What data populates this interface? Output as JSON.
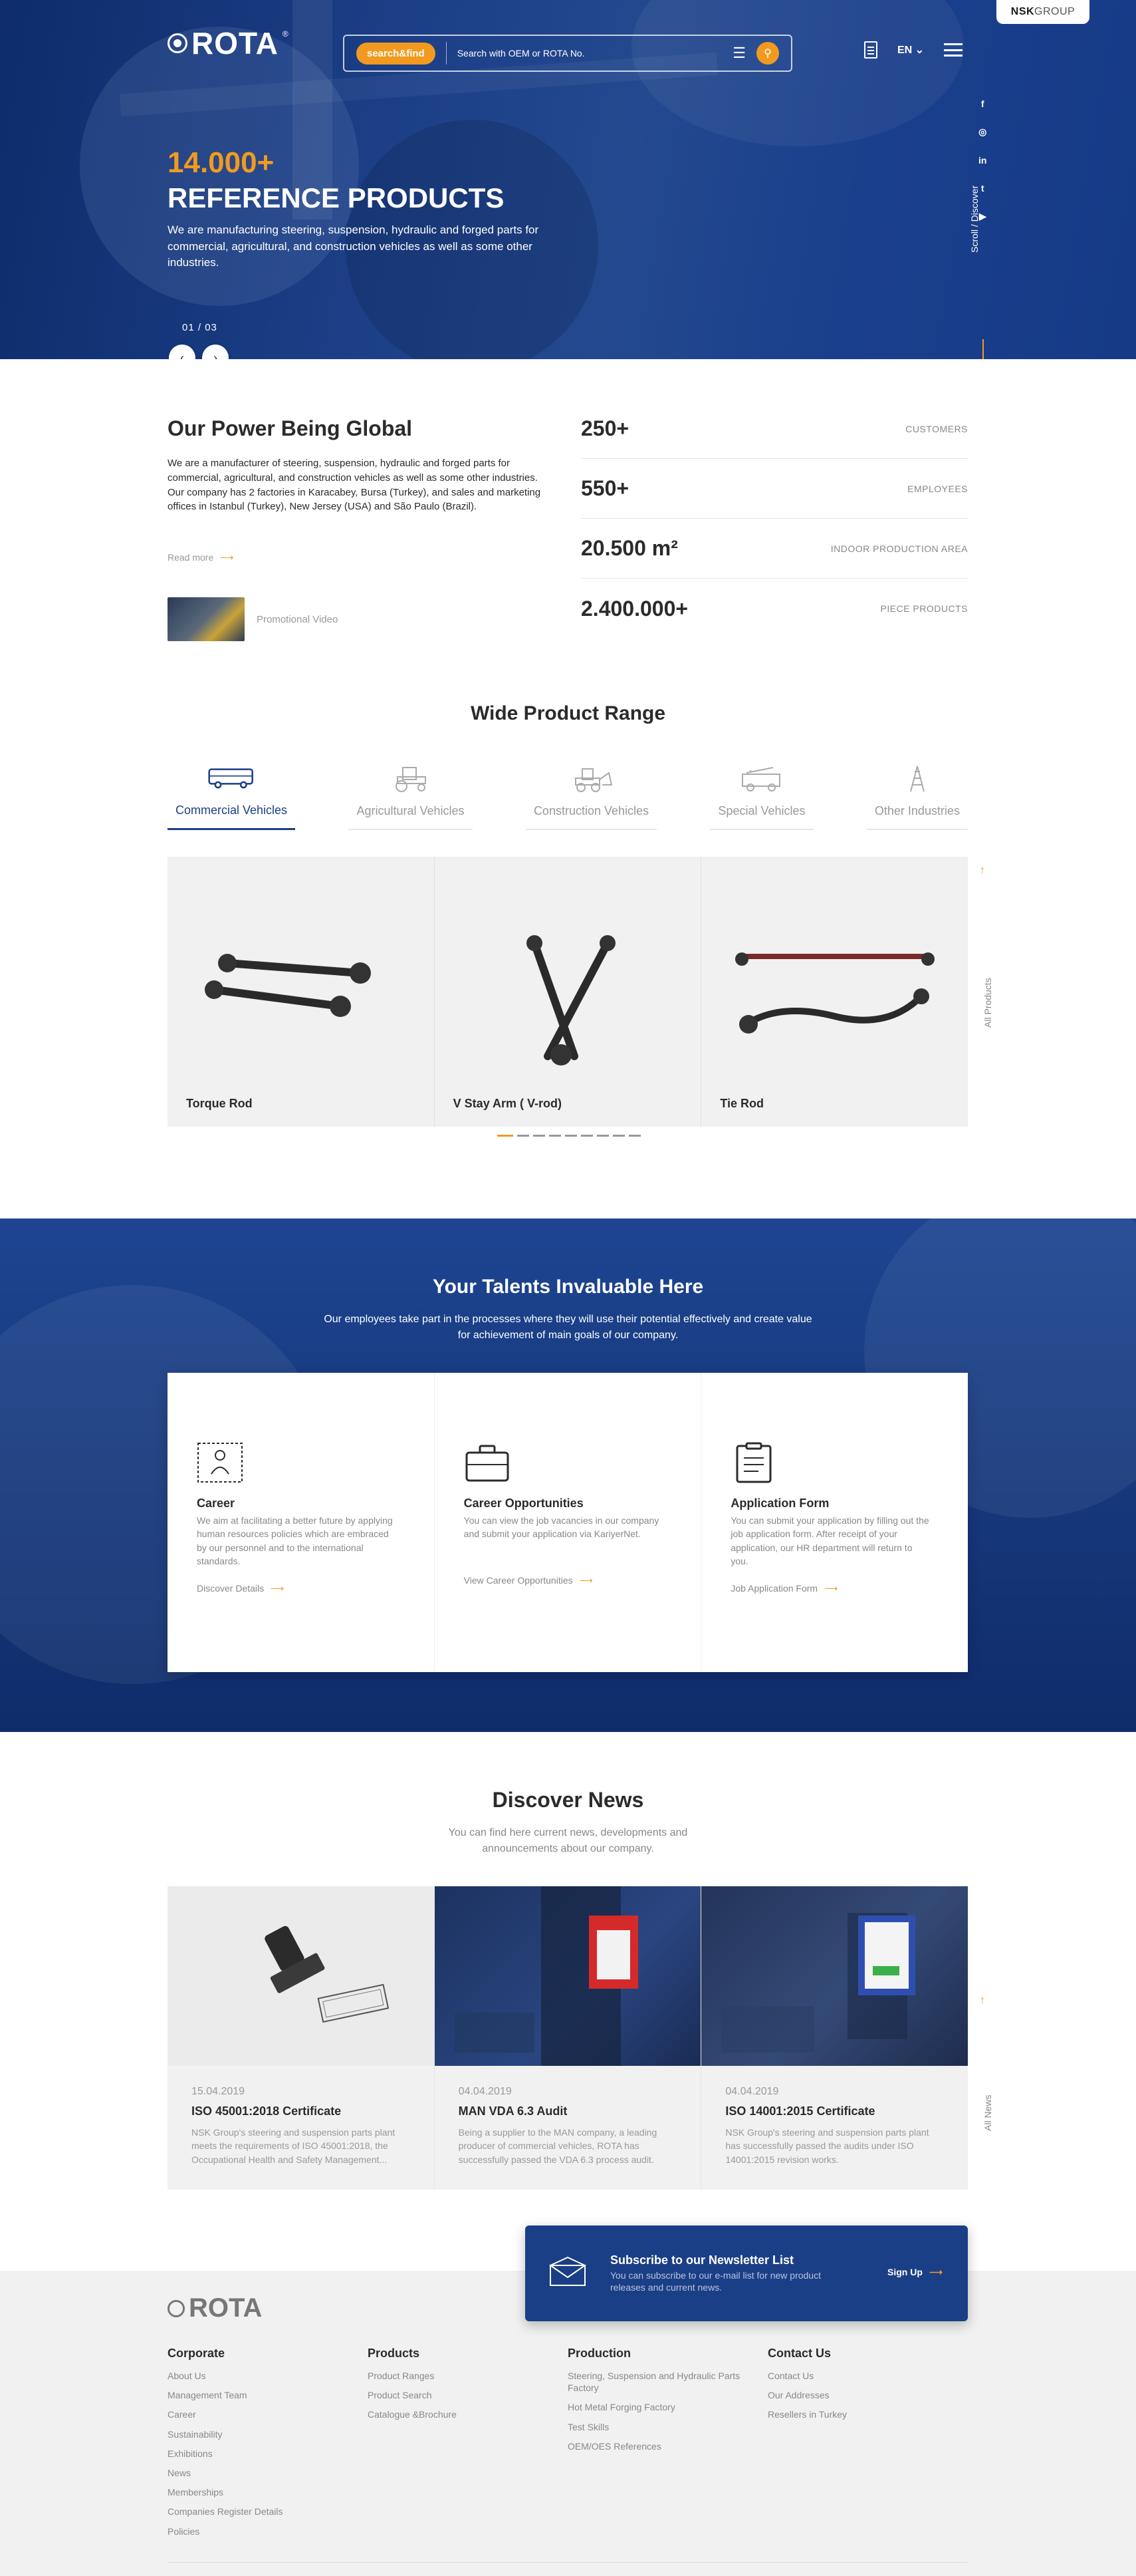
{
  "header": {
    "brand": "ROTA",
    "brand_reg": "®",
    "group_badge": {
      "prefix": "NSK",
      "suffix": "GROUP"
    },
    "search": {
      "badge_label": "search&find",
      "placeholder": "Search with OEM or ROTA No."
    },
    "language": "EN",
    "social": [
      "f",
      "◎",
      "in",
      "t",
      "▶"
    ],
    "scroll_label": "Scroll / Discover"
  },
  "hero": {
    "number": "14.000+",
    "title": "REFERENCE PRODUCTS",
    "description": "We are manufacturing steering, suspension, hydraulic and forged parts for commercial, agricultural, and construction vehicles as well as some other industries.",
    "pager_current": "01",
    "pager_sep": "/",
    "pager_total": "03"
  },
  "global": {
    "title": "Our Power Being Global",
    "text": "We are a manufacturer of steering, suspension, hydraulic and forged parts for commercial, agricultural, and construction vehicles as well as some other industries. Our company has 2 factories in Karacabey, Bursa (Turkey), and sales and marketing offices in Istanbul (Turkey), New Jersey (USA) and São Paulo (Brazil).",
    "read_more": "Read more",
    "video_label": "Promotional Video",
    "stats": [
      {
        "value": "250+",
        "label": "CUSTOMERS"
      },
      {
        "value": "550+",
        "label": "EMPLOYEES"
      },
      {
        "value": "20.500 m²",
        "label": "INDOOR PRODUCTION AREA"
      },
      {
        "value": "2.400.000+",
        "label": "PIECE PRODUCTS"
      }
    ]
  },
  "products": {
    "title": "Wide Product Range",
    "tabs": [
      {
        "label": "Commercial Vehicles",
        "icon": "bus-icon"
      },
      {
        "label": "Agricultural Vehicles",
        "icon": "tractor-icon"
      },
      {
        "label": "Construction Vehicles",
        "icon": "loader-icon"
      },
      {
        "label": "Special Vehicles",
        "icon": "fire-truck-icon"
      },
      {
        "label": "Other Industries",
        "icon": "tower-icon"
      }
    ],
    "cards": [
      {
        "name": "Torque Rod"
      },
      {
        "name": "V Stay Arm ( V-rod)"
      },
      {
        "name": "Tie Rod"
      }
    ],
    "all_label": "All Products",
    "slide_count": 9,
    "slide_active": 1
  },
  "talents": {
    "title": "Your Talents Invaluable Here",
    "subtitle": "Our employees take part in the processes where they will use their potential effectively and create value for achievement of main goals of our company.",
    "cards": [
      {
        "icon": "career-icon",
        "title": "Career",
        "text": "We aim at facilitating a better future by applying human resources policies which are embraced by our personnel and to the international standards.",
        "link": "Discover Details"
      },
      {
        "icon": "briefcase-icon",
        "title": "Career Opportunities",
        "text": "You can view the job vacancies in our company and submit your application via KariyerNet.",
        "link": "View Career Opportunities"
      },
      {
        "icon": "clipboard-icon",
        "title": "Application Form",
        "text": "You can submit your application by filling out the job application form. After receipt of your application, our HR department will return to you.",
        "link": "Job Application Form"
      }
    ]
  },
  "news": {
    "title": "Discover News",
    "subtitle": "You can find here current news, developments and announcements about our company.",
    "all_label": "All News",
    "cards": [
      {
        "date": "15.04.2019",
        "title": "ISO 45001:2018 Certificate",
        "text": "NSK Group's steering and suspension parts plant meets the requirements of ISO 45001:2018, the Occupational Health and Safety Management..."
      },
      {
        "date": "04.04.2019",
        "title": "MAN VDA 6.3 Audit",
        "text": "Being a supplier to the MAN company, a leading producer of commercial vehicles, ROTA has successfully passed the VDA 6.3 process audit."
      },
      {
        "date": "04.04.2019",
        "title": "ISO 14001:2015 Certificate",
        "text": "NSK Group's steering and suspension parts plant has successfully passed the audits under ISO 14001:2015 revision works."
      }
    ]
  },
  "newsletter": {
    "title": "Subscribe to our Newsletter List",
    "text": "You can subscribe to our e-mail list for new product releases and current news.",
    "button": "Sign Up"
  },
  "footer": {
    "brand": "ROTA",
    "columns": [
      {
        "title": "Corporate",
        "items": [
          "About Us",
          "Management Team",
          "Career",
          "Sustainability",
          "Exhibitions",
          "News",
          "Memberships",
          "Companies Register Details",
          "Policies"
        ]
      },
      {
        "title": "Products",
        "items": [
          "Product Ranges",
          "Product Search",
          "Catalogue &Brochure"
        ]
      },
      {
        "title": "Production",
        "items": [
          "Steering, Suspension and Hydraulic Parts Factory",
          "Hot Metal Forging Factory",
          "Test Skills",
          "OEM/OES References"
        ]
      },
      {
        "title": "Contact Us",
        "items": [
          "Contact Us",
          "Our Addresses",
          "Resellers in Turkey"
        ]
      }
    ]
  },
  "colors": {
    "primary": "#1b3f86",
    "accent": "#f29a1f"
  }
}
